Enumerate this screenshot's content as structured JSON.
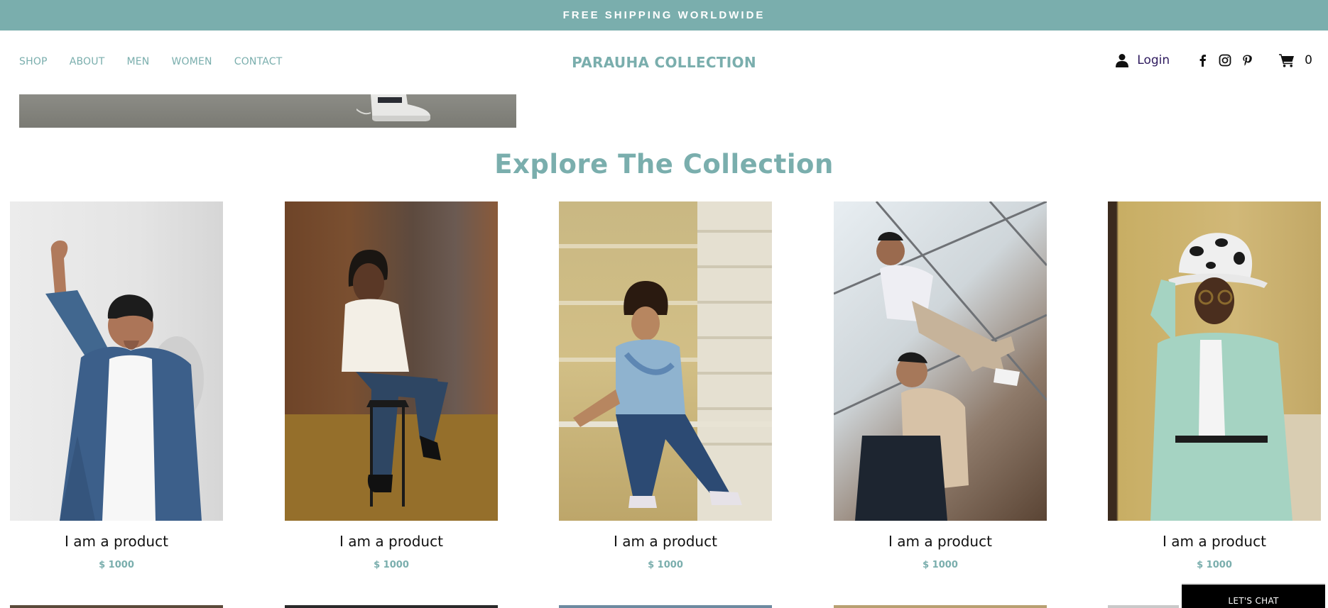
{
  "announcement": "FREE SHIPPING WORLDWIDE",
  "brand": "PARAUHA COLLECTION",
  "nav": [
    {
      "label": "SHOP"
    },
    {
      "label": "ABOUT"
    },
    {
      "label": "MEN"
    },
    {
      "label": "WOMEN"
    },
    {
      "label": "CONTACT"
    }
  ],
  "header": {
    "login_label": "Login",
    "cart_count": "0",
    "social_icons": [
      "facebook-icon",
      "instagram-icon",
      "pinterest-icon"
    ]
  },
  "section_title": "Explore The Collection",
  "products": [
    {
      "name": "I am a product",
      "price": "$ 1000"
    },
    {
      "name": "I am a product",
      "price": "$ 1000"
    },
    {
      "name": "I am a product",
      "price": "$ 1000"
    },
    {
      "name": "I am a product",
      "price": "$ 1000"
    },
    {
      "name": "I am a product",
      "price": "$ 1000"
    }
  ],
  "chat_label": "LET'S CHAT",
  "colors": {
    "accent": "#7aaead",
    "login_text": "#2e1a5e",
    "chat_bg": "#000000"
  }
}
